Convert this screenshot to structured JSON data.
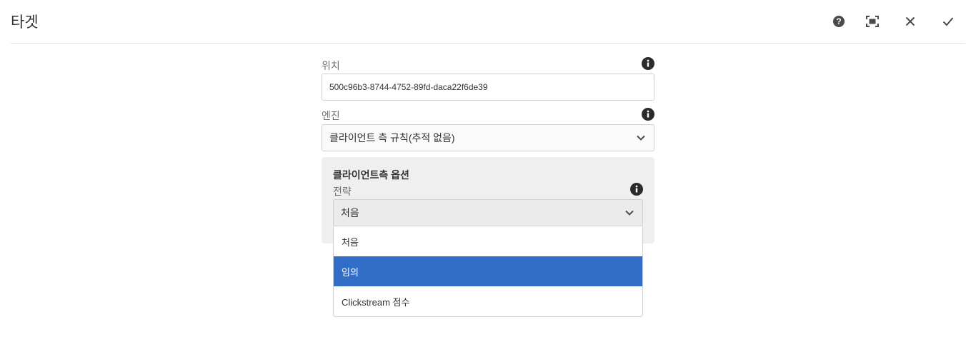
{
  "header": {
    "title": "타겟"
  },
  "location": {
    "label": "위치",
    "value": "500c96b3-8744-4752-89fd-daca22f6de39"
  },
  "engine": {
    "label": "엔진",
    "selected": "클라이언트 측 규칙(추적 없음)"
  },
  "client_options": {
    "title": "클라이언트측 옵션",
    "strategy_label": "전략",
    "strategy_selected": "처음",
    "options": [
      {
        "label": "처음",
        "selected": false
      },
      {
        "label": "임의",
        "selected": true
      },
      {
        "label": "Clickstream 점수",
        "selected": false
      }
    ]
  },
  "colors": {
    "accent": "#326ec8",
    "icon": "#2b2b2b"
  }
}
